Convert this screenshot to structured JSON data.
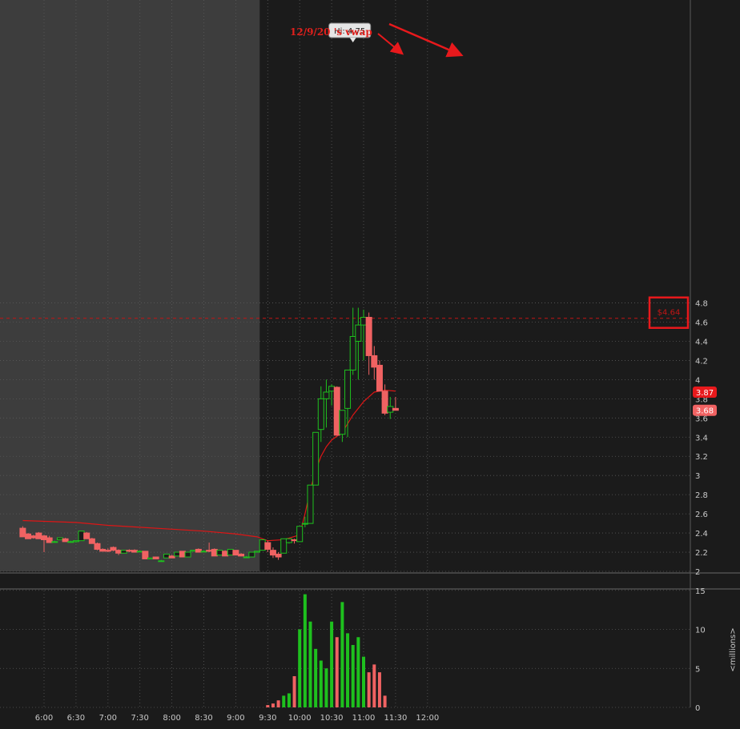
{
  "chart_data": {
    "type": "candlestick",
    "timeframe": "5 min",
    "x_tick_labels": [
      "6:00",
      "6:30",
      "7:00",
      "7:30",
      "8:00",
      "8:30",
      "9:00",
      "9:30",
      "10:00",
      "10:30",
      "11:00",
      "11:30",
      "12:00"
    ],
    "price_axis": {
      "range": [
        2.0,
        4.9
      ],
      "ticks": [
        "2",
        "2.2",
        "2.4",
        "2.6",
        "2.8",
        "3",
        "3.2",
        "3.4",
        "3.6",
        "3.8",
        "4",
        "4.2",
        "4.4",
        "4.6",
        "4.8"
      ]
    },
    "volume_axis": {
      "range": [
        0,
        16
      ],
      "ticks": [
        "0",
        "5",
        "10",
        "15"
      ],
      "label": "<millions>"
    },
    "session_open_time": "9:30",
    "candles": [
      [
        "5:40",
        2.45,
        2.47,
        2.37,
        2.36
      ],
      [
        "5:45",
        2.39,
        2.4,
        2.34,
        2.34
      ],
      [
        "5:50",
        2.37,
        2.38,
        2.34,
        2.35
      ],
      [
        "5:55",
        2.4,
        2.41,
        2.34,
        2.34
      ],
      [
        "6:00",
        2.37,
        2.38,
        2.2,
        2.33
      ],
      [
        "6:05",
        2.35,
        2.37,
        2.3,
        2.3
      ],
      [
        "6:10",
        2.31,
        2.32,
        2.3,
        2.31
      ],
      [
        "6:15",
        2.33,
        2.35,
        2.33,
        2.35
      ],
      [
        "6:20",
        2.34,
        2.35,
        2.31,
        2.31
      ],
      [
        "6:25",
        2.31,
        2.32,
        2.3,
        2.31
      ],
      [
        "6:30",
        2.31,
        2.32,
        2.3,
        2.32
      ],
      [
        "6:35",
        2.32,
        2.42,
        2.32,
        2.42
      ],
      [
        "6:40",
        2.4,
        2.41,
        2.34,
        2.34
      ],
      [
        "6:45",
        2.34,
        2.35,
        2.29,
        2.29
      ],
      [
        "6:50",
        2.29,
        2.3,
        2.22,
        2.23
      ],
      [
        "6:55",
        2.23,
        2.24,
        2.21,
        2.21
      ],
      [
        "7:00",
        2.22,
        2.24,
        2.2,
        2.21
      ],
      [
        "7:05",
        2.25,
        2.26,
        2.21,
        2.22
      ],
      [
        "7:10",
        2.22,
        2.23,
        2.17,
        2.19
      ],
      [
        "7:15",
        2.19,
        2.22,
        2.19,
        2.22
      ],
      [
        "7:20",
        2.22,
        2.23,
        2.2,
        2.21
      ],
      [
        "7:25",
        2.22,
        2.23,
        2.2,
        2.2
      ],
      [
        "7:30",
        2.21,
        2.22,
        2.2,
        2.21
      ],
      [
        "7:35",
        2.21,
        2.21,
        2.13,
        2.13
      ],
      [
        "7:40",
        2.13,
        2.14,
        2.13,
        2.14
      ],
      [
        "7:45",
        2.15,
        2.15,
        2.13,
        2.13
      ],
      [
        "7:50",
        2.11,
        2.12,
        2.1,
        2.11
      ],
      [
        "7:55",
        2.14,
        2.18,
        2.14,
        2.18
      ],
      [
        "8:00",
        2.16,
        2.17,
        2.14,
        2.14
      ],
      [
        "8:05",
        2.16,
        2.2,
        2.16,
        2.2
      ],
      [
        "8:10",
        2.21,
        2.21,
        2.15,
        2.15
      ],
      [
        "8:15",
        2.15,
        2.2,
        2.15,
        2.2
      ],
      [
        "8:20",
        2.21,
        2.22,
        2.21,
        2.22
      ],
      [
        "8:25",
        2.23,
        2.24,
        2.2,
        2.2
      ],
      [
        "8:30",
        2.21,
        2.22,
        2.2,
        2.21
      ],
      [
        "8:35",
        2.22,
        2.3,
        2.2,
        2.21
      ],
      [
        "8:40",
        2.23,
        2.24,
        2.16,
        2.16
      ],
      [
        "8:45",
        2.17,
        2.22,
        2.17,
        2.22
      ],
      [
        "8:50",
        2.21,
        2.22,
        2.16,
        2.16
      ],
      [
        "8:55",
        2.17,
        2.23,
        2.17,
        2.23
      ],
      [
        "9:00",
        2.22,
        2.22,
        2.17,
        2.17
      ],
      [
        "9:05",
        2.18,
        2.19,
        2.16,
        2.16
      ],
      [
        "9:10",
        2.15,
        2.16,
        2.14,
        2.15
      ],
      [
        "9:15",
        2.15,
        2.2,
        2.15,
        2.2
      ],
      [
        "9:20",
        2.2,
        2.21,
        2.21,
        2.21
      ],
      [
        "9:25",
        2.22,
        2.33,
        2.22,
        2.33
      ],
      [
        "9:30",
        2.3,
        2.32,
        2.2,
        2.23
      ],
      [
        "9:35",
        2.22,
        2.25,
        2.14,
        2.17
      ],
      [
        "9:40",
        2.18,
        2.2,
        2.12,
        2.15
      ],
      [
        "9:45",
        2.19,
        2.34,
        2.19,
        2.34
      ],
      [
        "9:50",
        2.3,
        2.34,
        2.29,
        2.34
      ],
      [
        "9:55",
        2.33,
        2.34,
        2.29,
        2.32
      ],
      [
        "10:00",
        2.31,
        2.47,
        2.31,
        2.47
      ],
      [
        "10:05",
        2.5,
        2.57,
        2.46,
        2.5
      ],
      [
        "10:10",
        2.5,
        2.7,
        2.5,
        2.9
      ],
      [
        "10:15",
        2.9,
        3.45,
        2.9,
        3.45
      ],
      [
        "10:20",
        3.48,
        3.93,
        3.35,
        3.8
      ],
      [
        "10:25",
        3.8,
        4.0,
        3.5,
        3.87
      ],
      [
        "10:30",
        3.88,
        3.95,
        3.73,
        3.93
      ],
      [
        "10:35",
        3.92,
        3.93,
        3.42,
        3.42
      ],
      [
        "10:40",
        3.43,
        3.65,
        3.35,
        3.68
      ],
      [
        "10:45",
        3.7,
        4.1,
        3.4,
        4.1
      ],
      [
        "10:50",
        4.1,
        4.75,
        4.05,
        4.45
      ],
      [
        "10:55",
        4.4,
        4.75,
        4.0,
        4.57
      ],
      [
        "11:00",
        4.57,
        4.73,
        4.2,
        4.65
      ],
      [
        "11:05",
        4.65,
        4.7,
        4.05,
        4.25
      ],
      [
        "11:10",
        4.25,
        4.35,
        4.0,
        4.13
      ],
      [
        "11:15",
        4.15,
        4.2,
        3.88,
        3.88
      ],
      [
        "11:20",
        3.88,
        3.95,
        3.63,
        3.65
      ],
      [
        "11:25",
        3.66,
        3.82,
        3.59,
        3.72
      ],
      [
        "11:30",
        3.7,
        3.82,
        3.69,
        3.68
      ]
    ],
    "volumes": [
      {
        "x": "9:30",
        "v": 0.3
      },
      {
        "x": "9:35",
        "v": 0.5
      },
      {
        "x": "9:40",
        "v": 0.9
      },
      {
        "x": "9:45",
        "v": 1.5
      },
      {
        "x": "9:50",
        "v": 1.8
      },
      {
        "x": "9:55",
        "v": 4.0
      },
      {
        "x": "10:00",
        "v": 10.0
      },
      {
        "x": "10:05",
        "v": 14.5
      },
      {
        "x": "10:10",
        "v": 11.0
      },
      {
        "x": "10:15",
        "v": 7.5
      },
      {
        "x": "10:20",
        "v": 6.0
      },
      {
        "x": "10:25",
        "v": 5.0
      },
      {
        "x": "10:30",
        "v": 11.0
      },
      {
        "x": "10:35",
        "v": 9.0
      },
      {
        "x": "10:40",
        "v": 13.5
      },
      {
        "x": "10:45",
        "v": 9.5
      },
      {
        "x": "10:50",
        "v": 8.0
      },
      {
        "x": "10:55",
        "v": 9.0
      },
      {
        "x": "11:00",
        "v": 6.5
      },
      {
        "x": "11:05",
        "v": 4.5
      },
      {
        "x": "11:10",
        "v": 5.5
      },
      {
        "x": "11:15",
        "v": 4.5
      },
      {
        "x": "11:20",
        "v": 1.5
      }
    ],
    "vwap_line": [
      [
        "5:40",
        2.53
      ],
      [
        "6:30",
        2.51
      ],
      [
        "7:00",
        2.48
      ],
      [
        "7:30",
        2.46
      ],
      [
        "8:00",
        2.44
      ],
      [
        "8:30",
        2.42
      ],
      [
        "9:00",
        2.39
      ],
      [
        "9:20",
        2.36
      ],
      [
        "9:30",
        2.32
      ],
      [
        "9:45",
        2.33
      ],
      [
        "10:00",
        2.38
      ],
      [
        "10:05",
        2.6
      ],
      [
        "10:10",
        2.85
      ],
      [
        "10:15",
        3.05
      ],
      [
        "10:20",
        3.2
      ],
      [
        "10:25",
        3.3
      ],
      [
        "10:30",
        3.37
      ],
      [
        "10:40",
        3.45
      ],
      [
        "10:50",
        3.63
      ],
      [
        "11:00",
        3.77
      ],
      [
        "11:10",
        3.87
      ],
      [
        "11:20",
        3.89
      ],
      [
        "11:30",
        3.88
      ]
    ],
    "prev_vwap_level": 4.64,
    "price_labels": [
      {
        "text": "3.87",
        "value": 3.87,
        "color": "#e8191c"
      },
      {
        "text": "3.68",
        "value": 3.68,
        "color": "#f06262"
      }
    ],
    "hi_label": "Hi: 4.75",
    "hi_at": "10:50",
    "vwap_box_label": "$4.64",
    "annotation": "12/9/20 's vwap",
    "colors": {
      "up": "#1ec01e",
      "down": "#f06262",
      "vwap_line": "#dd1616",
      "premarket_bg": "#3d3d3d",
      "session_bg": "#1b1b1b"
    }
  }
}
